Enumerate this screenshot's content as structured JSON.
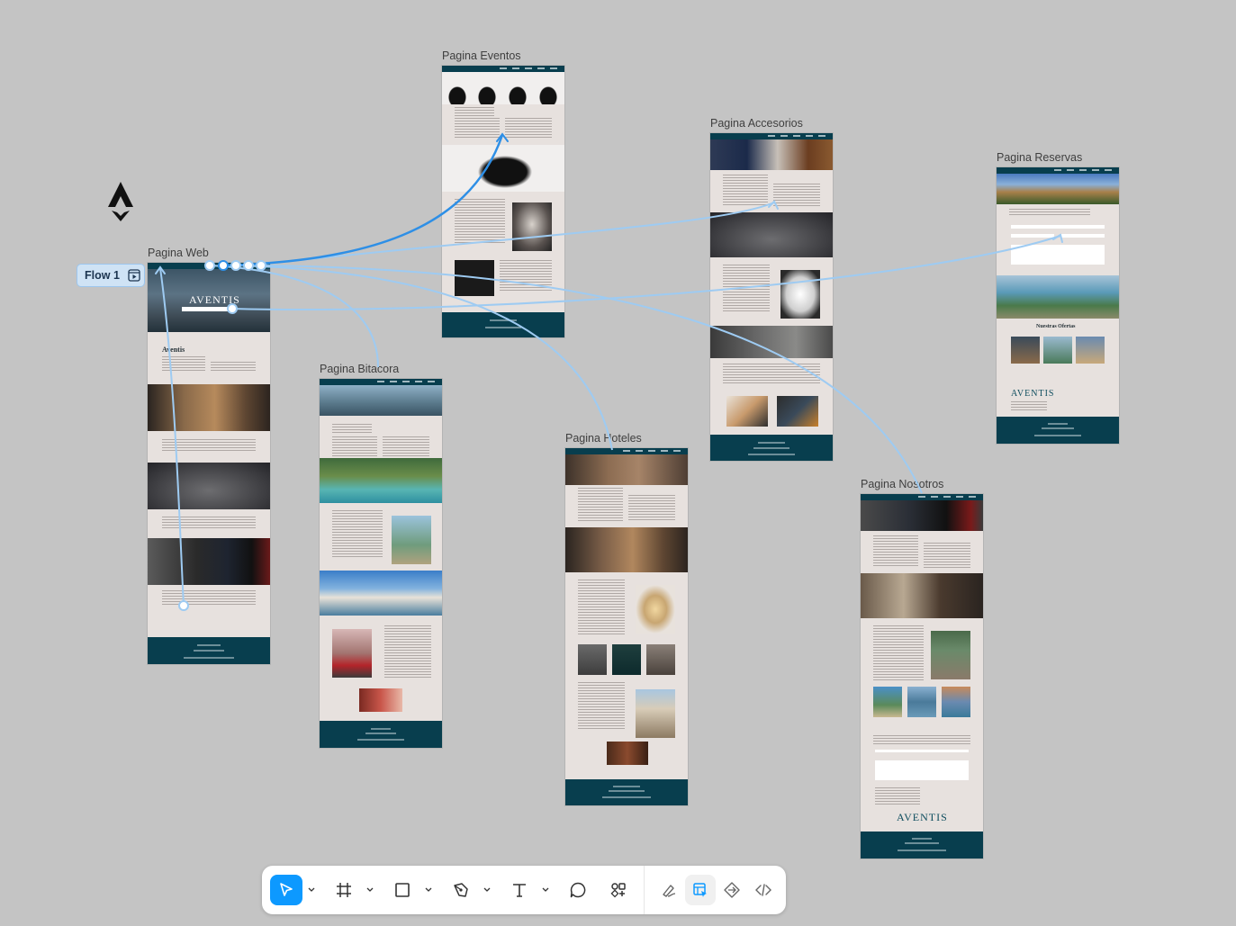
{
  "canvas": {
    "background": "#c4c4c4",
    "frames": [
      {
        "key": "web",
        "label": "Pagina Web",
        "brand": "AVENTIS",
        "hero_heading": "Aventis"
      },
      {
        "key": "bitacora",
        "label": "Pagina Bitacora"
      },
      {
        "key": "eventos",
        "label": "Pagina Eventos"
      },
      {
        "key": "hoteles",
        "label": "Pagina Hoteles"
      },
      {
        "key": "accesorios",
        "label": "Pagina Accesorios"
      },
      {
        "key": "nosotros",
        "label": "Pagina Nosotros",
        "brand": "AVENTIS"
      },
      {
        "key": "reservas",
        "label": "Pagina Reservas",
        "section_heading": "Nuestras Ofertas",
        "brand": "AVENTIS"
      }
    ]
  },
  "flow": {
    "label": "Flow 1",
    "icon": "play-flow-icon",
    "color": "#2e8fe6",
    "connector_color": "#9ecbf2"
  },
  "colors": {
    "frame_bg": "#e7e1de",
    "nav_footer": "#083e4e",
    "accent": "#0d99ff"
  },
  "toolbar": {
    "tools": [
      {
        "name": "move-tool",
        "icon": "cursor-icon",
        "active": true
      },
      {
        "name": "frame-tool",
        "icon": "hash-frame-icon"
      },
      {
        "name": "shape-tool",
        "icon": "rectangle-icon"
      },
      {
        "name": "pen-tool",
        "icon": "pen-icon"
      },
      {
        "name": "text-tool",
        "icon": "text-icon"
      },
      {
        "name": "comment-tool",
        "icon": "comment-icon"
      },
      {
        "name": "assets-tool",
        "icon": "components-icon"
      },
      {
        "name": "draw-mode",
        "icon": "draw-icon"
      },
      {
        "name": "design-mode",
        "icon": "design-icon",
        "active": true
      },
      {
        "name": "prototype-mode",
        "icon": "prototype-icon"
      },
      {
        "name": "dev-mode",
        "icon": "code-icon"
      }
    ]
  }
}
